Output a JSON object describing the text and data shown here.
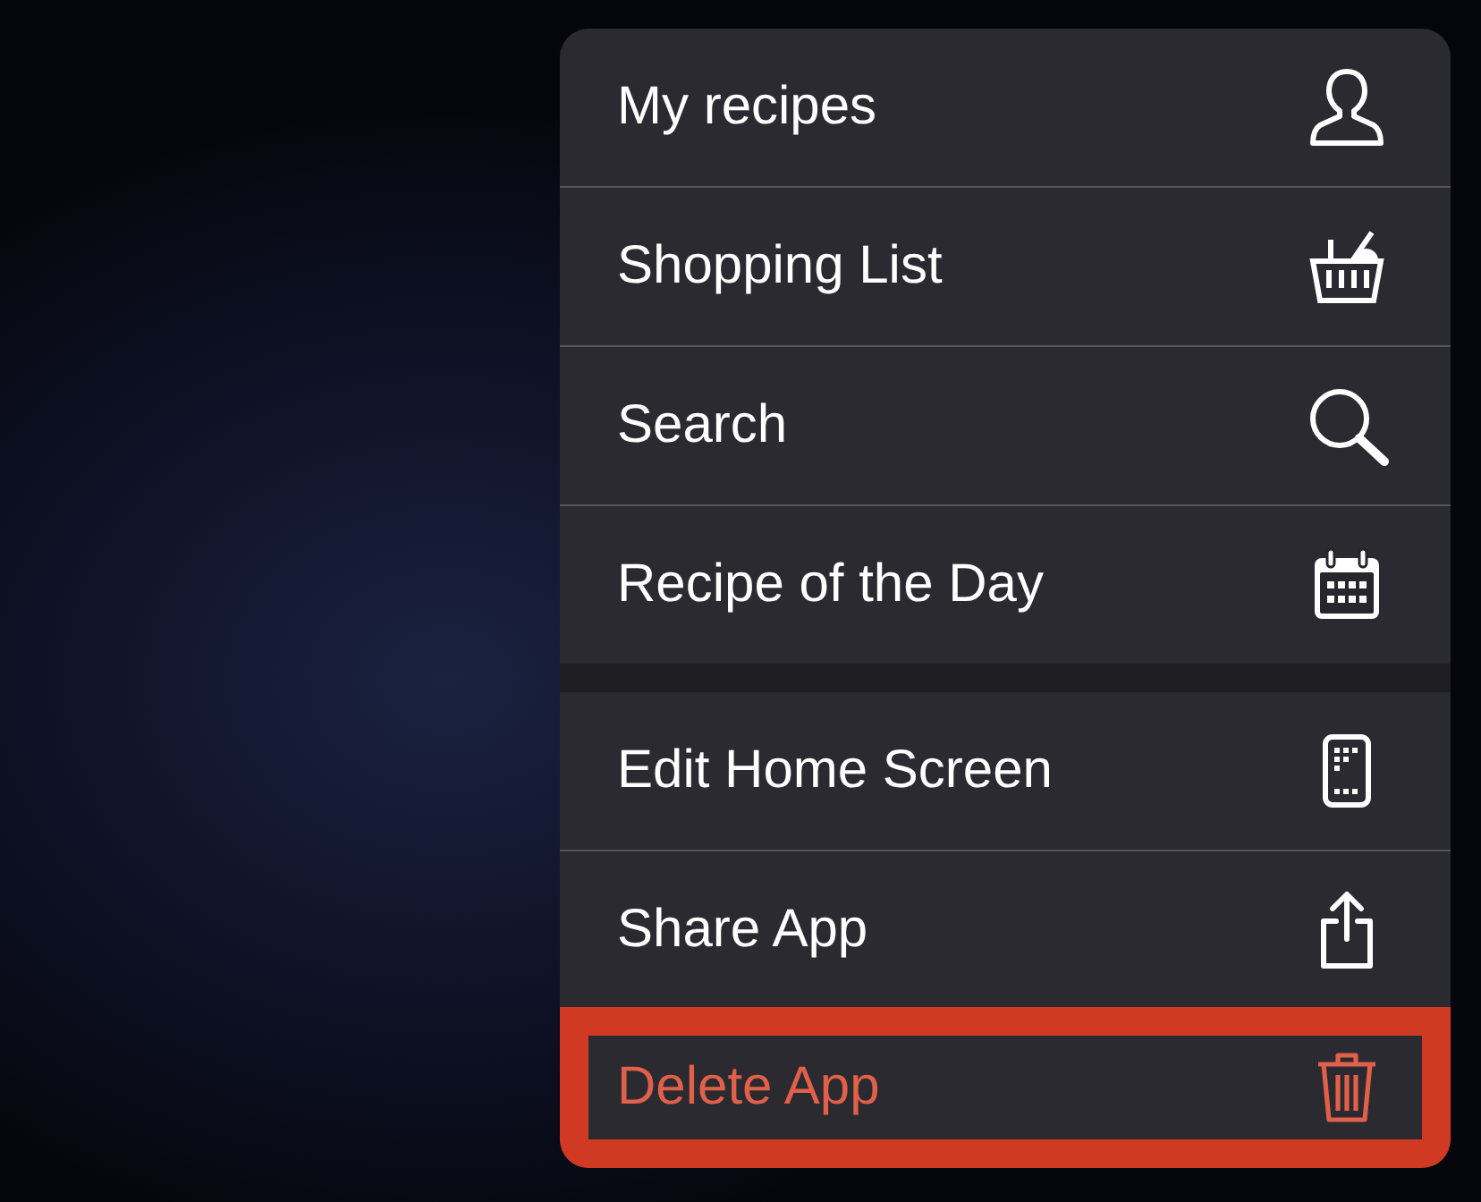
{
  "menu": {
    "groups": [
      {
        "items": [
          {
            "label": "My recipes",
            "kind": "person",
            "destructive": false,
            "highlighted": false
          },
          {
            "label": "Shopping List",
            "kind": "basket",
            "destructive": false,
            "highlighted": false
          },
          {
            "label": "Search",
            "kind": "search",
            "destructive": false,
            "highlighted": false
          },
          {
            "label": "Recipe of the Day",
            "kind": "calendar",
            "destructive": false,
            "highlighted": false
          }
        ]
      },
      {
        "items": [
          {
            "label": "Edit Home Screen",
            "kind": "phone",
            "destructive": false,
            "highlighted": false
          },
          {
            "label": "Share App",
            "kind": "share",
            "destructive": false,
            "highlighted": false
          },
          {
            "label": "Delete App",
            "kind": "trash",
            "destructive": true,
            "highlighted": true
          }
        ]
      }
    ]
  }
}
